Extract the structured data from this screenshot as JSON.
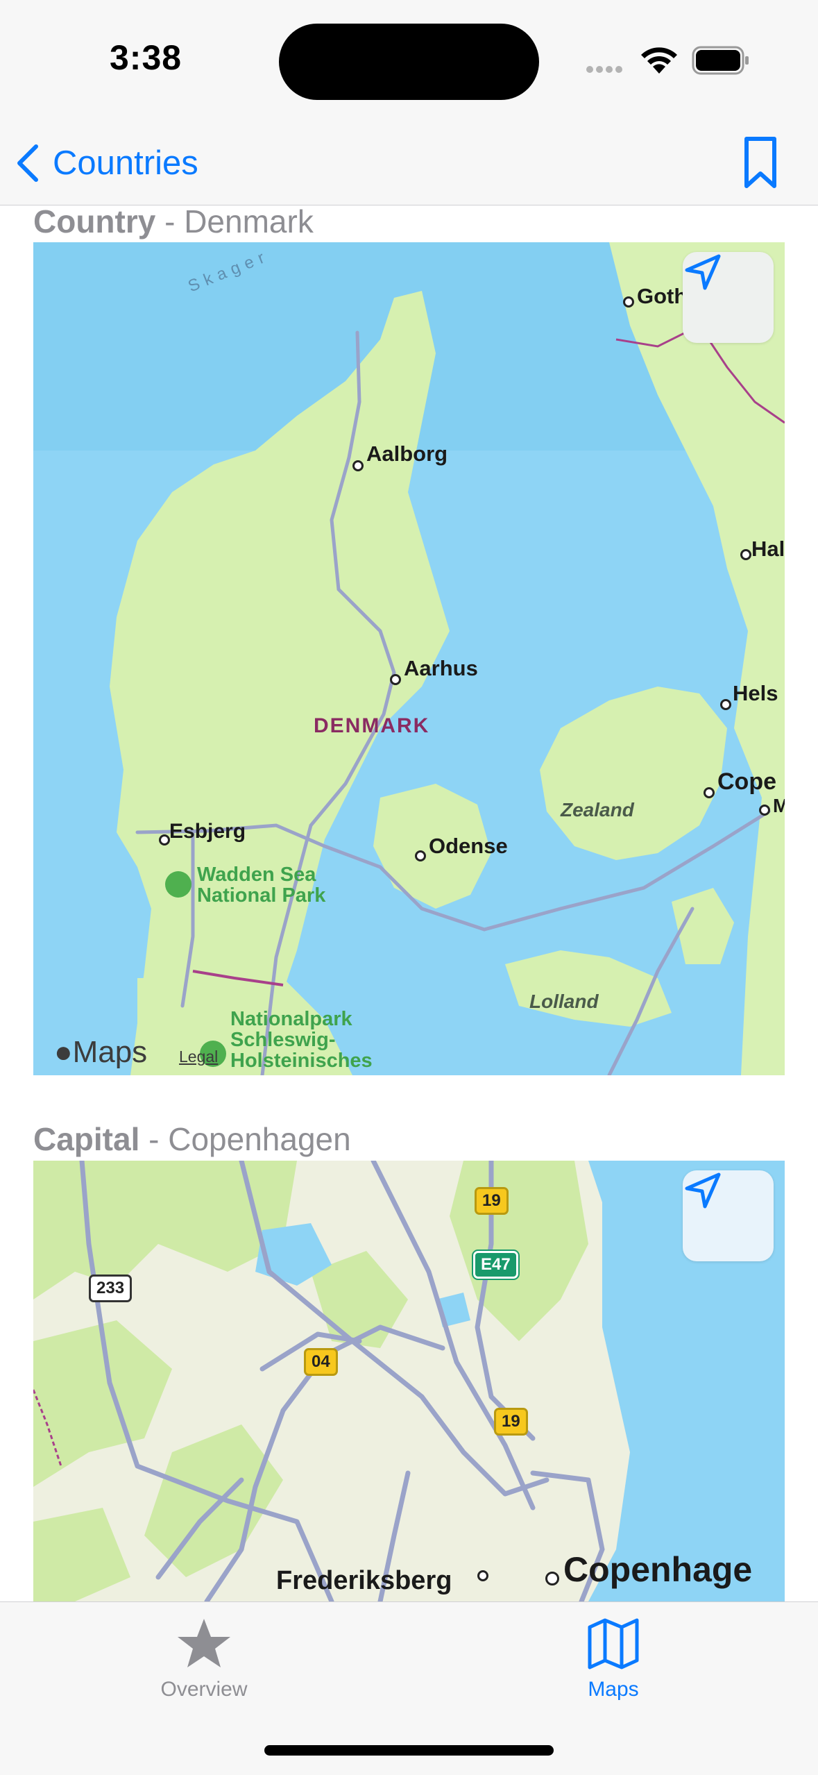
{
  "status_bar": {
    "time": "3:38"
  },
  "nav": {
    "back_label": "Countries",
    "back_icon": "chevron-left-icon",
    "bookmark_icon": "bookmark-icon"
  },
  "sections": {
    "country": {
      "heading_bold": "Country",
      "heading_rest": " - Denmark"
    },
    "capital": {
      "heading_bold": "Capital",
      "heading_rest": " - Copenhagen"
    }
  },
  "map1": {
    "labels": {
      "skagerrak": "Skager",
      "goth": "Goth",
      "aalborg": "Aalborg",
      "hal": "Hal",
      "aarhus": "Aarhus",
      "denmark": "DENMARK",
      "hels": "Hels",
      "cope": "Cope",
      "m": "M",
      "zealand": "Zealand",
      "esbjerg": "Esbjerg",
      "odense": "Odense",
      "wadden1": "Wadden Sea",
      "wadden2": "National Park",
      "lolland": "Lolland",
      "np1": "Nationalpark",
      "np2": "Schleswig-",
      "np3": "Holsteinisches"
    },
    "attribution": "Maps",
    "legal": "Legal"
  },
  "map2": {
    "shields": {
      "r19a": "19",
      "e47": "E47",
      "r233": "233",
      "r04": "04",
      "r19b": "19"
    },
    "labels": {
      "copenhagen": "Copenhage",
      "frederiksberg": "Frederiksberg"
    }
  },
  "tabs": [
    {
      "label": "Overview",
      "icon": "star-icon",
      "color": "#8e8e93"
    },
    {
      "label": "Maps",
      "icon": "map-icon",
      "color": "#0a7aff"
    }
  ],
  "colors": {
    "accent": "#0a7aff",
    "water": "#8fd3f4",
    "land": "#d6f0b0"
  }
}
